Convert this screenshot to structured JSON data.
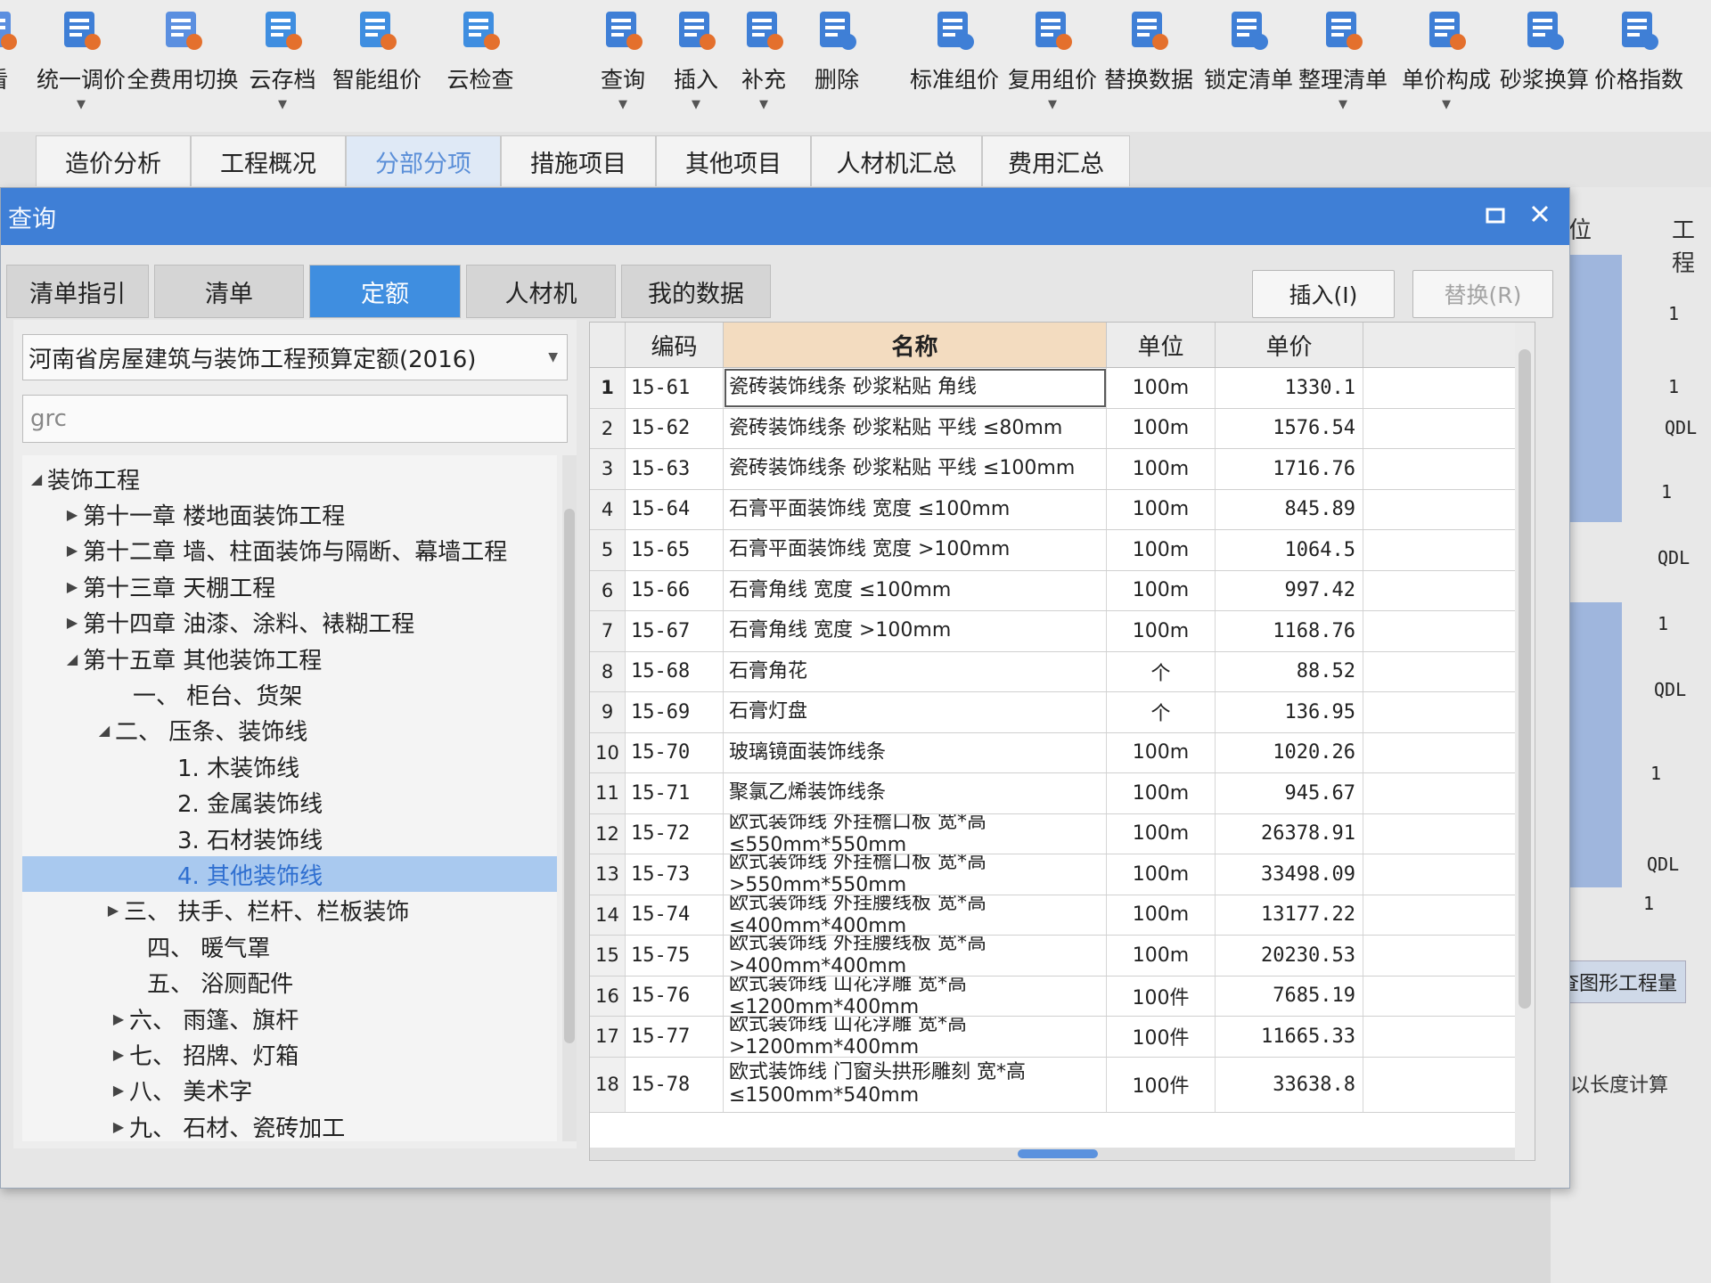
{
  "toolbar": {
    "items": [
      {
        "label": "看",
        "icon": "view-icon"
      },
      {
        "label": "统一调价",
        "icon": "adjust-price-icon"
      },
      {
        "label": "全费用切换",
        "icon": "full-cost-switch-icon"
      },
      {
        "label": "云存档",
        "icon": "cloud-save-icon"
      },
      {
        "label": "智能组价",
        "icon": "smart-pricing-icon"
      },
      {
        "label": "云检查",
        "icon": "cloud-check-icon"
      },
      {
        "label": "查询",
        "icon": "query-icon"
      },
      {
        "label": "插入",
        "icon": "insert-icon"
      },
      {
        "label": "补充",
        "icon": "supplement-icon"
      },
      {
        "label": "删除",
        "icon": "delete-icon"
      },
      {
        "label": "标准组价",
        "icon": "standard-pricing-icon"
      },
      {
        "label": "复用组价",
        "icon": "reuse-pricing-icon"
      },
      {
        "label": "替换数据",
        "icon": "replace-data-icon"
      },
      {
        "label": "锁定清单",
        "icon": "lock-list-icon"
      },
      {
        "label": "整理清单",
        "icon": "organize-list-icon"
      },
      {
        "label": "单价构成",
        "icon": "unit-price-icon"
      },
      {
        "label": "砂浆换算",
        "icon": "mortar-convert-icon"
      },
      {
        "label": "价格指数",
        "icon": "price-index-icon"
      }
    ]
  },
  "main_tabs": [
    "造价分析",
    "工程概况",
    "分部分项",
    "措施项目",
    "其他项目",
    "人材机汇总",
    "费用汇总"
  ],
  "dialog": {
    "title": "查询",
    "tabs": [
      "清单指引",
      "清单",
      "定额",
      "人材机",
      "我的数据"
    ],
    "insert_button": "插入(I)",
    "replace_button": "替换(R)",
    "quota_select": "河南省房屋建筑与装饰工程预算定额(2016)",
    "search_value": "grc",
    "tree": [
      {
        "label": "装饰工程"
      },
      {
        "label": "第十一章 楼地面装饰工程"
      },
      {
        "label": "第十二章 墙、柱面装饰与隔断、幕墙工程"
      },
      {
        "label": "第十三章 天棚工程"
      },
      {
        "label": "第十四章 油漆、涂料、裱糊工程"
      },
      {
        "label": "第十五章 其他装饰工程"
      },
      {
        "label": "一、 柜台、货架"
      },
      {
        "label": "二、 压条、装饰线"
      },
      {
        "label": "1. 木装饰线"
      },
      {
        "label": "2. 金属装饰线"
      },
      {
        "label": "3. 石材装饰线"
      },
      {
        "label": "4. 其他装饰线"
      },
      {
        "label": "三、 扶手、栏杆、栏板装饰"
      },
      {
        "label": "四、 暖气罩"
      },
      {
        "label": "五、 浴厕配件"
      },
      {
        "label": "六、 雨篷、旗杆"
      },
      {
        "label": "七、 招牌、灯箱"
      },
      {
        "label": "八、 美术字"
      },
      {
        "label": "九、 石材、瓷砖加工"
      }
    ],
    "columns": [
      "编码",
      "名称",
      "单位",
      "单价"
    ],
    "rows": [
      {
        "idx": "1",
        "code": "15-61",
        "name": "瓷砖装饰线条 砂浆粘贴 角线",
        "unit": "100m",
        "price": "1330.1"
      },
      {
        "idx": "2",
        "code": "15-62",
        "name": "瓷砖装饰线条 砂浆粘贴 平线 ≤80mm",
        "unit": "100m",
        "price": "1576.54"
      },
      {
        "idx": "3",
        "code": "15-63",
        "name": "瓷砖装饰线条 砂浆粘贴 平线 ≤100mm",
        "unit": "100m",
        "price": "1716.76"
      },
      {
        "idx": "4",
        "code": "15-64",
        "name": "石膏平面装饰线 宽度 ≤100mm",
        "unit": "100m",
        "price": "845.89"
      },
      {
        "idx": "5",
        "code": "15-65",
        "name": "石膏平面装饰线 宽度 >100mm",
        "unit": "100m",
        "price": "1064.5"
      },
      {
        "idx": "6",
        "code": "15-66",
        "name": "石膏角线 宽度 ≤100mm",
        "unit": "100m",
        "price": "997.42"
      },
      {
        "idx": "7",
        "code": "15-67",
        "name": "石膏角线 宽度 >100mm",
        "unit": "100m",
        "price": "1168.76"
      },
      {
        "idx": "8",
        "code": "15-68",
        "name": "石膏角花",
        "unit": "个",
        "price": "88.52"
      },
      {
        "idx": "9",
        "code": "15-69",
        "name": "石膏灯盘",
        "unit": "个",
        "price": "136.95"
      },
      {
        "idx": "10",
        "code": "15-70",
        "name": "玻璃镜面装饰线条",
        "unit": "100m",
        "price": "1020.26"
      },
      {
        "idx": "11",
        "code": "15-71",
        "name": "聚氯乙烯装饰线条",
        "unit": "100m",
        "price": "945.67"
      },
      {
        "idx": "12",
        "code": "15-72",
        "name": "欧式装饰线 外挂檐口板 宽*高≤550mm*550mm",
        "unit": "100m",
        "price": "26378.91"
      },
      {
        "idx": "13",
        "code": "15-73",
        "name": "欧式装饰线 外挂檐口板 宽*高>550mm*550mm",
        "unit": "100m",
        "price": "33498.09"
      },
      {
        "idx": "14",
        "code": "15-74",
        "name": "欧式装饰线 外挂腰线板 宽*高≤400mm*400mm",
        "unit": "100m",
        "price": "13177.22"
      },
      {
        "idx": "15",
        "code": "15-75",
        "name": "欧式装饰线 外挂腰线板 宽*高>400mm*400mm",
        "unit": "100m",
        "price": "20230.53"
      },
      {
        "idx": "16",
        "code": "15-76",
        "name": "欧式装饰线 山花浮雕 宽*高≤1200mm*400mm",
        "unit": "100件",
        "price": "7685.19"
      },
      {
        "idx": "17",
        "code": "15-77",
        "name": "欧式装饰线 山花浮雕 宽*高>1200mm*400mm",
        "unit": "100件",
        "price": "11665.33"
      },
      {
        "idx": "18",
        "code": "15-78",
        "name": "欧式装饰线 门窗头拱形雕刻 宽*高 ≤1500mm*540mm",
        "unit": "100件",
        "price": "33638.8"
      }
    ]
  },
  "background_right": {
    "header": "位",
    "header2": "工程",
    "cells": [
      "1",
      "1",
      "QDL",
      "1",
      "QDL",
      "1",
      "QDL",
      "1",
      "QDL",
      "1"
    ],
    "bottom_tab": "查图形工程量",
    "bottom_text": "寸以长度计算"
  },
  "colors": {
    "title_bar": "#3f7fd6",
    "active_tab": "#3f8ee0",
    "selected_tree": "#a9c9ef",
    "name_header": "#f3dcc0"
  }
}
